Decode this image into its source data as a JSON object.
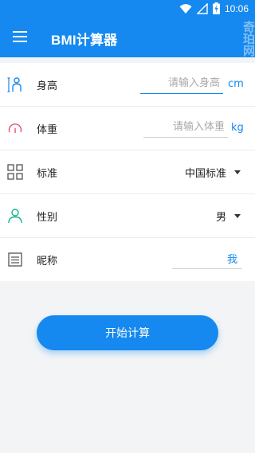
{
  "status_bar": {
    "time": "10:06",
    "battery_icon": "battery-charging-icon",
    "wifi_icon": "wifi-icon",
    "signal_icon": "signal-icon"
  },
  "app_bar": {
    "title": "BMI计算器",
    "menu_icon": "hamburger-menu-icon"
  },
  "form": {
    "height": {
      "label": "身高",
      "placeholder": "请输入身高",
      "unit": "cm",
      "icon": "person-height-icon"
    },
    "weight": {
      "label": "体重",
      "placeholder": "请输入体重",
      "unit": "kg",
      "icon": "scale-gauge-icon"
    },
    "standard": {
      "label": "标准",
      "value": "中国标准",
      "icon": "grid-icon"
    },
    "gender": {
      "label": "性别",
      "value": "男",
      "icon": "person-icon"
    },
    "nickname": {
      "label": "昵称",
      "value": "我",
      "icon": "document-icon"
    }
  },
  "actions": {
    "start_label": "开始计算"
  },
  "colors": {
    "primary": "#1589ef",
    "background": "#f3f4f6"
  }
}
